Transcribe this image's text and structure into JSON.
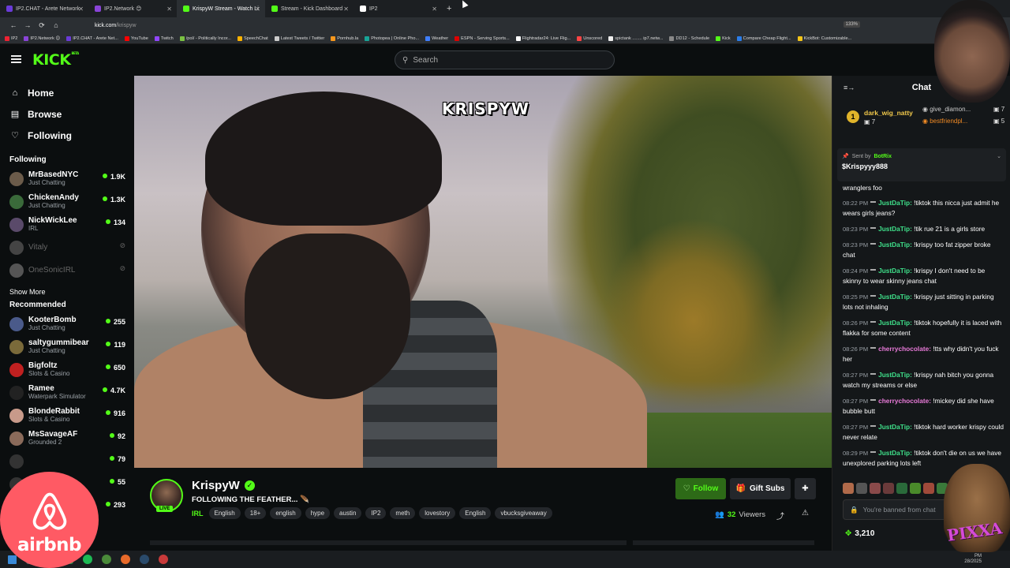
{
  "browser": {
    "tabs": [
      {
        "label": "IP2.CHAT - Arete Network",
        "color": "#6a3bd8"
      },
      {
        "label": "IP2.Network 😊",
        "color": "#8a44d8"
      },
      {
        "label": "KrispyW Stream - Watch Li",
        "color": "#53fc18",
        "active": true
      },
      {
        "label": "Stream - Kick Dashboard",
        "color": "#53fc18"
      },
      {
        "label": "IP2",
        "color": "#ffffff"
      }
    ],
    "new_tab": "+",
    "url_host": "kick.com",
    "url_path": "/krispyw",
    "zoom": "133%",
    "bookmarks": [
      {
        "label": "IP2",
        "color": "#e23"
      },
      {
        "label": "IP2.Network 😊",
        "color": "#8a44d8"
      },
      {
        "label": "IP2.CHAT - Arete Net...",
        "color": "#6a3bd8"
      },
      {
        "label": "YouTube",
        "color": "#f00"
      },
      {
        "label": "Twitch",
        "color": "#9146ff"
      },
      {
        "label": "/pol/ - Politically Incor...",
        "color": "#7ac142"
      },
      {
        "label": "SpeechChat",
        "color": "#ffb300"
      },
      {
        "label": "Latest Tweets / Twitter",
        "color": "#ccc"
      },
      {
        "label": "Pornhub.la",
        "color": "#f7971d"
      },
      {
        "label": "Photopea | Online Pho...",
        "color": "#18a497"
      },
      {
        "label": "Weather",
        "color": "#3f7fff"
      },
      {
        "label": "ESPN - Serving Sports...",
        "color": "#d00"
      },
      {
        "label": "Flightradar24: Live Flig...",
        "color": "#fff"
      },
      {
        "label": "Unscored",
        "color": "#f44"
      },
      {
        "label": "spictank ........ ip7.netw...",
        "color": "#eee"
      },
      {
        "label": "DD12 - Schedule",
        "color": "#888"
      },
      {
        "label": "Kick",
        "color": "#53fc18"
      },
      {
        "label": "Compare Cheap Flight...",
        "color": "#2b7de9"
      },
      {
        "label": "KickBot: Customizable...",
        "color": "#f5c518"
      }
    ]
  },
  "kick": {
    "logo": "KICK",
    "logo_sup": "BETA",
    "search_placeholder": "Search",
    "nav": [
      {
        "label": "Home",
        "icon": "⌂"
      },
      {
        "label": "Browse",
        "icon": "▤"
      },
      {
        "label": "Following",
        "icon": "♡"
      }
    ],
    "following_heading": "Following",
    "following": [
      {
        "name": "MrBasedNYC",
        "category": "Just Chatting",
        "viewers": "1.9K",
        "color": "#6b5b4a"
      },
      {
        "name": "ChickenAndy",
        "category": "Just Chatting",
        "viewers": "1.3K",
        "color": "#3a6a3a"
      },
      {
        "name": "NickWickLee",
        "category": "IRL",
        "viewers": "134",
        "color": "#5a4a6a"
      },
      {
        "name": "Vitaly",
        "category": "",
        "viewers": "",
        "offline": true,
        "color": "#444"
      },
      {
        "name": "OneSonicIRL",
        "category": "",
        "viewers": "",
        "offline": true,
        "color": "#555"
      }
    ],
    "show_more": "Show More",
    "recommended_heading": "Recommended",
    "recommended": [
      {
        "name": "KooterBomb",
        "category": "Just Chatting",
        "viewers": "255",
        "color": "#4a5a8a"
      },
      {
        "name": "saltygummibear",
        "category": "Just Chatting",
        "viewers": "119",
        "color": "#7a6a3a"
      },
      {
        "name": "Bigfoltz",
        "category": "Slots & Casino",
        "viewers": "650",
        "color": "#c02020"
      },
      {
        "name": "Ramee",
        "category": "Waterpark Simulator",
        "viewers": "4.7K",
        "color": "#222"
      },
      {
        "name": "BlondeRabbit",
        "category": "Slots & Casino",
        "viewers": "916",
        "color": "#c89a8a"
      },
      {
        "name": "MsSavageAF",
        "category": "Grounded 2",
        "viewers": "92",
        "color": "#8a6a5a"
      },
      {
        "name": "",
        "category": "",
        "viewers": "79",
        "color": "#333"
      },
      {
        "name": "",
        "category": "",
        "viewers": "55",
        "color": "#333"
      },
      {
        "name": "",
        "category": "",
        "viewers": "293",
        "color": "#333"
      }
    ]
  },
  "stream": {
    "watermark": "KRISPYW",
    "streamer": "KrispyW",
    "live_label": "LIVE",
    "title": "FOLLOWING THE FEATHER... 🪶",
    "category": "IRL",
    "tags": [
      "English",
      "18+",
      "english",
      "hype",
      "austin",
      "IP2",
      "meth",
      "lovestory",
      "English",
      "vbucksgiveaway"
    ],
    "follow_label": "Follow",
    "gift_label": "Gift Subs",
    "viewers_count": "32",
    "viewers_label": "Viewers"
  },
  "chat": {
    "title": "Chat",
    "leaderboard": [
      {
        "rank": "1",
        "name": "dark_wig_natty",
        "value": "7"
      },
      {
        "name": "give_diamon...",
        "value": "7"
      },
      {
        "name": "bestfriendpl...",
        "value": "5"
      }
    ],
    "pinned_sent_by": "Sent by",
    "pinned_user": "BotRix",
    "pinned_message": "$Krispyyy888",
    "first_line": "wranglers foo",
    "messages": [
      {
        "time": "08:22 PM",
        "user": "JustDaTip:",
        "color": "#3fe08a",
        "text": "!tiktok this nicca just admit he wears girls jeans?"
      },
      {
        "time": "08:23 PM",
        "user": "JustDaTip:",
        "color": "#3fe08a",
        "text": "!tik rue 21 is a girls store"
      },
      {
        "time": "08:23 PM",
        "user": "JustDaTip:",
        "color": "#3fe08a",
        "text": "!krispy too fat zipper broke chat"
      },
      {
        "time": "08:24 PM",
        "user": "JustDaTip:",
        "color": "#3fe08a",
        "text": "!krispy I don't need to be skinny to wear skinny jeans chat"
      },
      {
        "time": "08:25 PM",
        "user": "JustDaTip:",
        "color": "#3fe08a",
        "text": "!krispy just sitting in parking lots not inhaling"
      },
      {
        "time": "08:26 PM",
        "user": "JustDaTip:",
        "color": "#3fe08a",
        "text": "!tiktok hopefully it is laced with flakka for some content"
      },
      {
        "time": "08:26 PM",
        "user": "cherrychocolate:",
        "color": "#e87ad8",
        "text": "!tts why didn't you fuck her"
      },
      {
        "time": "08:27 PM",
        "user": "JustDaTip:",
        "color": "#3fe08a",
        "text": "!krispy nah bitch you gonna watch my streams or else"
      },
      {
        "time": "08:27 PM",
        "user": "cherrychocolate:",
        "color": "#e87ad8",
        "text": "!mickey did she have bubble butt"
      },
      {
        "time": "08:27 PM",
        "user": "JustDaTip:",
        "color": "#3fe08a",
        "text": "!tiktok hard worker krispy could never relate"
      },
      {
        "time": "08:29 PM",
        "user": "JustDaTip:",
        "color": "#3fe08a",
        "text": "!tiktok don't die on us we have unexplored parking lots left"
      }
    ],
    "input_placeholder": "You're banned from chat",
    "points": "3,210"
  },
  "overlays": {
    "airbnb_text": "airbnb",
    "chewie_text": "PIXXA",
    "clock_line1": "PM",
    "clock_line2": "28/2025"
  }
}
